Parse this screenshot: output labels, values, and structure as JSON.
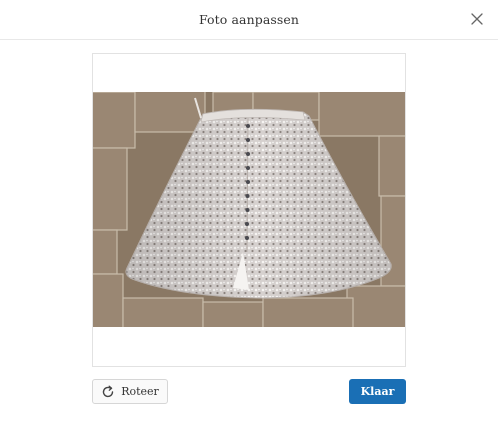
{
  "dialog": {
    "title": "Foto aanpassen"
  },
  "actions": {
    "rotate_label": "Roteer",
    "done_label": "Klaar"
  },
  "icons": {
    "close": "close-icon",
    "rotate": "rotate-icon"
  },
  "colors": {
    "primary_button": "#1a6fb5",
    "primary_text": "#ffffff",
    "secondary_button": "#fafafa"
  }
}
